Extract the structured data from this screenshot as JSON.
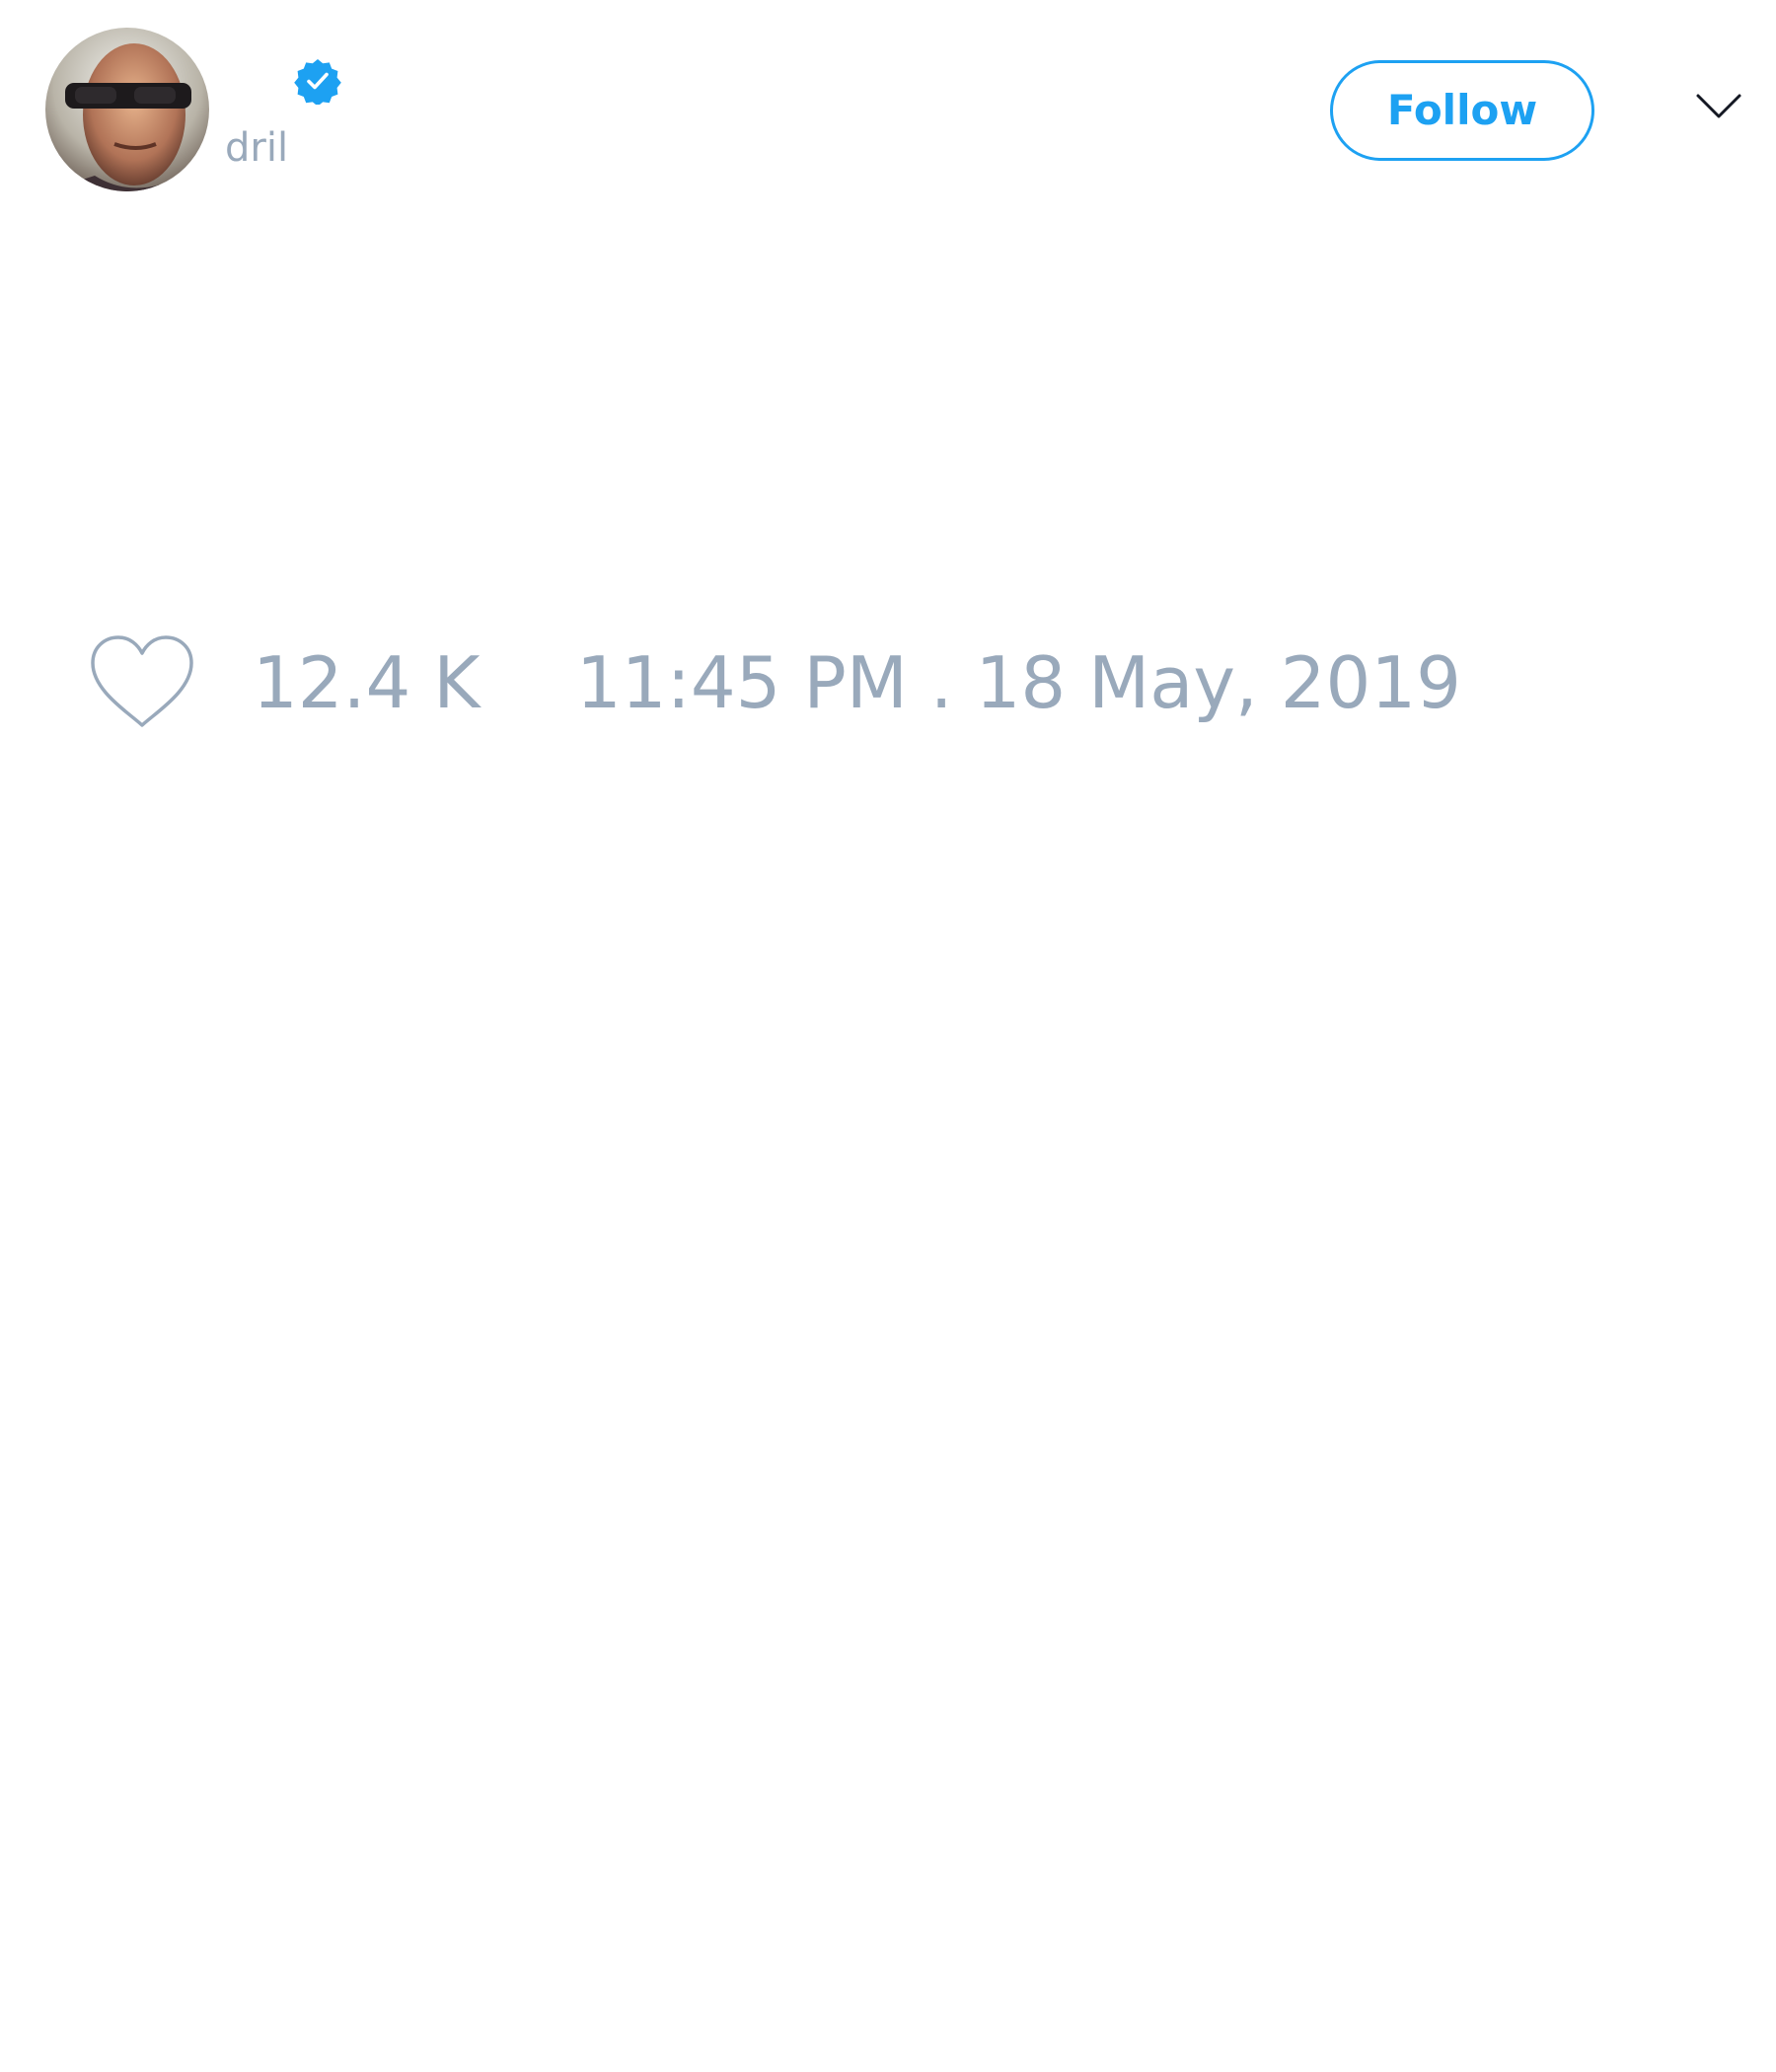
{
  "author": {
    "handle": "dril",
    "verified": true,
    "avatar_icon": "profile-photo",
    "verified_icon": "verified-badge-icon"
  },
  "header": {
    "follow_label": "Follow",
    "menu_icon": "chevron-down-icon"
  },
  "tweet": {
    "like_icon": "heart-outline-icon",
    "like_count": "12.4 K",
    "timestamp": "11:45 PM . 18 May, 2019"
  },
  "colors": {
    "accent": "#1da1f2",
    "muted_text": "#99a9bb",
    "background": "#ffffff"
  }
}
